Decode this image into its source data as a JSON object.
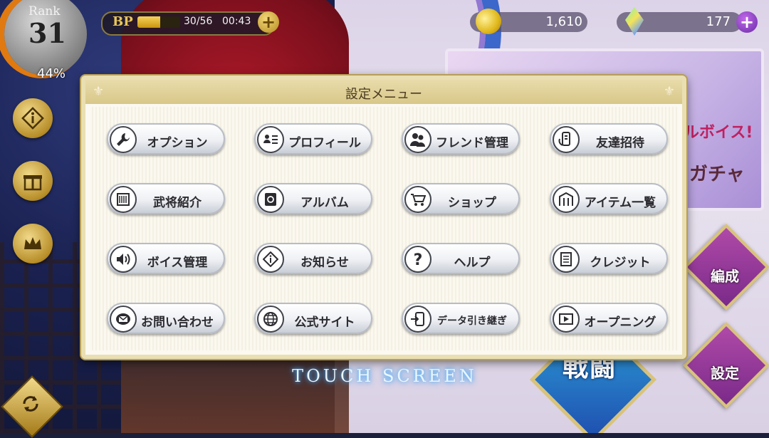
{
  "hud": {
    "rank_word": "Rank",
    "rank_value": "31",
    "rank_percent": "44%",
    "bp": {
      "label": "BP",
      "count": "30/56",
      "timer": "00:43",
      "fill": 0.54
    },
    "coins": "1,610",
    "gems": "177"
  },
  "dialog": {
    "title": "設定メニュー",
    "buttons": [
      {
        "label": "オプション",
        "icon": "wrench-icon"
      },
      {
        "label": "プロフィール",
        "icon": "profile-card-icon"
      },
      {
        "label": "フレンド管理",
        "icon": "friends-icon"
      },
      {
        "label": "友達招待",
        "icon": "invite-phone-icon"
      },
      {
        "label": "武将紹介",
        "icon": "scroll-icon"
      },
      {
        "label": "アルバム",
        "icon": "album-icon"
      },
      {
        "label": "ショップ",
        "icon": "cart-icon"
      },
      {
        "label": "アイテム一覧",
        "icon": "item-box-icon"
      },
      {
        "label": "ボイス管理",
        "icon": "speaker-icon"
      },
      {
        "label": "お知らせ",
        "icon": "info-icon"
      },
      {
        "label": "ヘルプ",
        "icon": "question-icon"
      },
      {
        "label": "クレジット",
        "icon": "document-icon"
      },
      {
        "label": "お問い合わせ",
        "icon": "mail-icon"
      },
      {
        "label": "公式サイト",
        "icon": "globe-icon"
      },
      {
        "label": "データ引き継ぎ",
        "icon": "transfer-icon"
      },
      {
        "label": "オープニング",
        "icon": "play-icon"
      }
    ]
  },
  "background": {
    "banner_text_1": "ルボイス!",
    "banner_text_2": "ガチャ",
    "menu_formation": "編成",
    "menu_settings": "設定",
    "menu_battle": "戦闘"
  },
  "touch_text": "TOUCH SCREEN",
  "colors": {
    "gold": "#d9c37a",
    "dialog_bg": "#fbf9f1",
    "touch_glow": "#49b6ff"
  }
}
